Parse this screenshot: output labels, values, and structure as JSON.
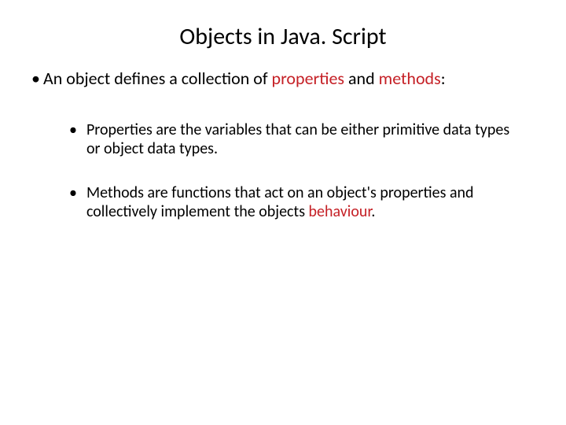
{
  "slide": {
    "title": "Objects in Java. Script",
    "main_bullet": {
      "prefix": "An object defines a collection of ",
      "highlight1": "properties",
      "middle": " and ",
      "highlight2": "methods",
      "suffix": ":"
    },
    "sub_bullets": [
      {
        "text": "Properties are the variables that can be either primitive data types or object data types."
      },
      {
        "prefix": "Methods are functions that act on an object's properties and collectively implement the objects ",
        "highlight": "behaviour",
        "suffix": "."
      }
    ]
  }
}
